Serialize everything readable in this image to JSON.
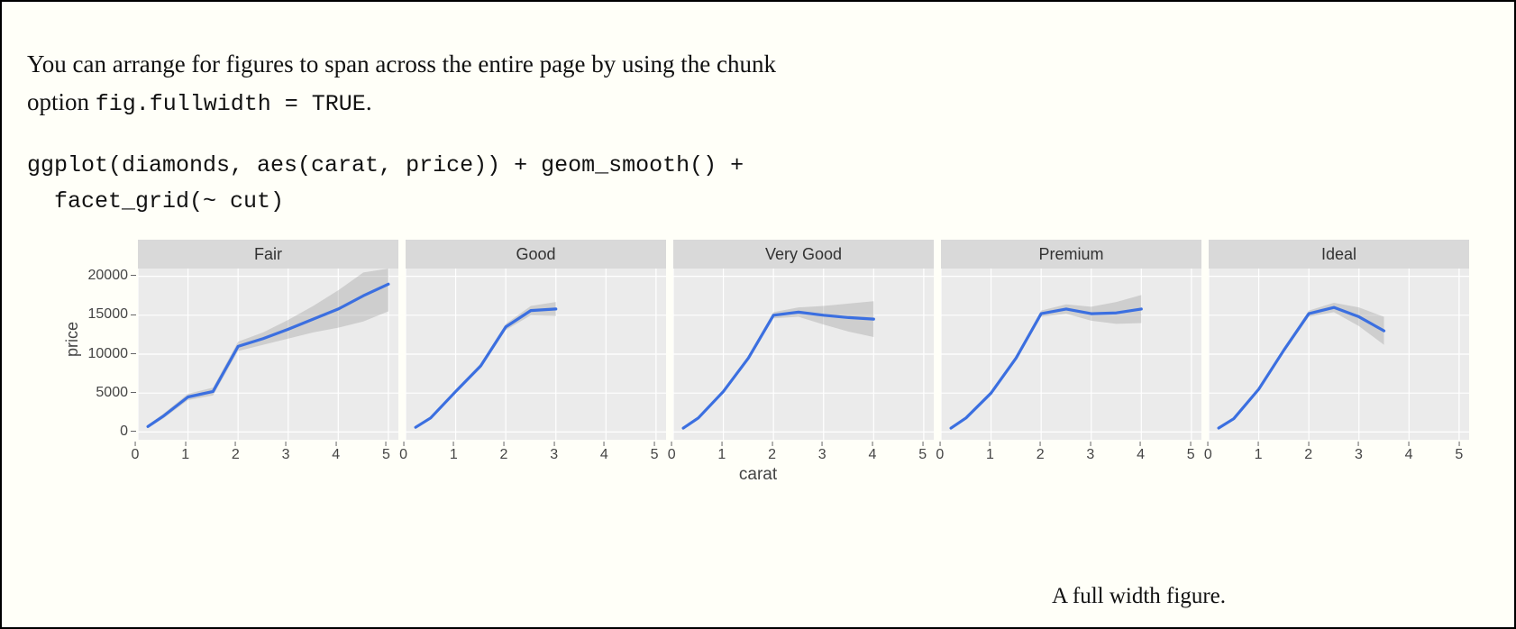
{
  "intro": {
    "text_before_code": "You can arrange for figures to span across the entire page by using the chunk option ",
    "code": "fig.fullwidth = TRUE",
    "text_after_code": "."
  },
  "code_block": "ggplot(diamonds, aes(carat, price)) + geom_smooth() +\n  facet_grid(~ cut)",
  "caption": "A full width figure.",
  "chart_data": {
    "type": "line",
    "xlabel": "carat",
    "ylabel": "price",
    "xlim": [
      0,
      5.2
    ],
    "ylim": [
      -1000,
      21000
    ],
    "x_ticks": [
      0,
      1,
      2,
      3,
      4,
      5
    ],
    "y_ticks": [
      0,
      5000,
      10000,
      15000,
      20000
    ],
    "facets": [
      {
        "name": "Fair",
        "x": [
          0.2,
          0.5,
          1.0,
          1.5,
          2.0,
          2.5,
          3.0,
          3.5,
          4.0,
          4.5,
          5.0
        ],
        "y": [
          700,
          2000,
          4500,
          5200,
          11000,
          12000,
          13200,
          14500,
          15800,
          17500,
          19000
        ],
        "lo": [
          500,
          1700,
          4100,
          4700,
          10400,
          11200,
          12000,
          12800,
          13400,
          14200,
          15500
        ],
        "hi": [
          900,
          2300,
          4900,
          5700,
          11600,
          12800,
          14400,
          16200,
          18200,
          20500,
          21000
        ]
      },
      {
        "name": "Good",
        "x": [
          0.2,
          0.5,
          1.0,
          1.5,
          2.0,
          2.5,
          3.0
        ],
        "y": [
          600,
          1800,
          5200,
          8500,
          13500,
          15600,
          15800
        ],
        "lo": [
          500,
          1600,
          5000,
          8200,
          13100,
          15000,
          14900
        ],
        "hi": [
          700,
          2000,
          5400,
          8800,
          13900,
          16200,
          16700
        ]
      },
      {
        "name": "Very Good",
        "x": [
          0.2,
          0.5,
          1.0,
          1.5,
          2.0,
          2.5,
          3.0,
          3.5,
          4.0
        ],
        "y": [
          500,
          1800,
          5200,
          9500,
          15000,
          15400,
          15000,
          14700,
          14500
        ],
        "lo": [
          400,
          1600,
          5000,
          9200,
          14600,
          14800,
          13800,
          12900,
          12200
        ],
        "hi": [
          600,
          2000,
          5400,
          9800,
          15400,
          16000,
          16200,
          16500,
          16800
        ]
      },
      {
        "name": "Premium",
        "x": [
          0.2,
          0.5,
          1.0,
          1.5,
          2.0,
          2.5,
          3.0,
          3.5,
          4.0
        ],
        "y": [
          500,
          1800,
          5000,
          9500,
          15200,
          15800,
          15200,
          15300,
          15800
        ],
        "lo": [
          400,
          1600,
          4800,
          9200,
          14800,
          15200,
          14300,
          13900,
          14000
        ],
        "hi": [
          600,
          2000,
          5200,
          9800,
          15600,
          16400,
          16100,
          16700,
          17600
        ]
      },
      {
        "name": "Ideal",
        "x": [
          0.2,
          0.5,
          1.0,
          1.5,
          2.0,
          2.5,
          3.0,
          3.5
        ],
        "y": [
          500,
          1700,
          5500,
          10500,
          15200,
          16000,
          14800,
          13000
        ],
        "lo": [
          400,
          1500,
          5300,
          10200,
          14800,
          15400,
          13600,
          11200
        ],
        "hi": [
          600,
          1900,
          5700,
          10800,
          15600,
          16600,
          16000,
          14800
        ]
      }
    ]
  }
}
